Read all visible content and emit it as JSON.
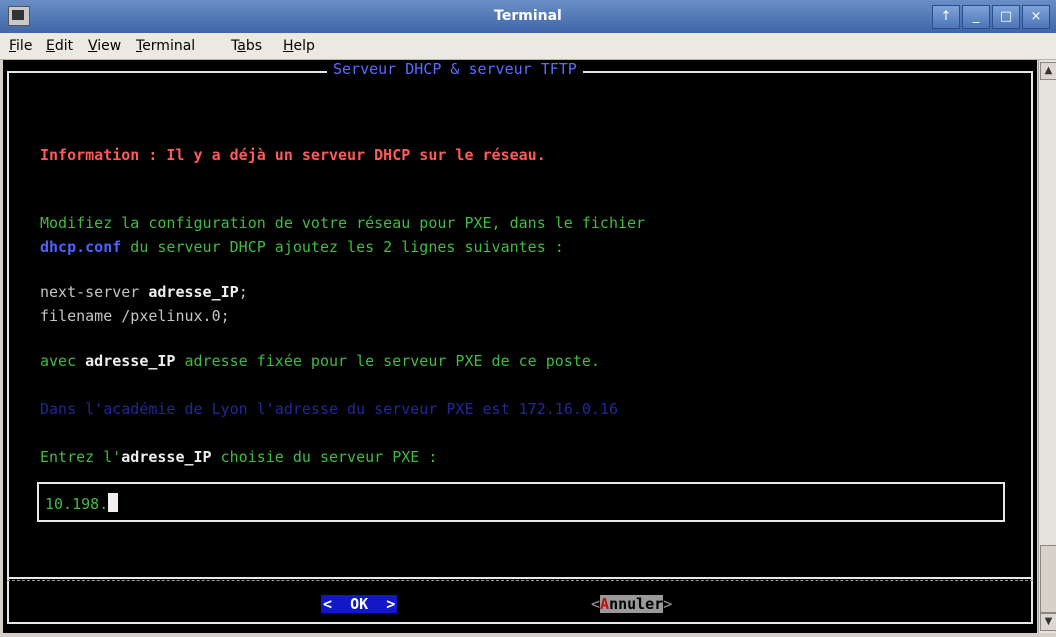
{
  "window": {
    "title": "Terminal",
    "buttons": {
      "up": "↑",
      "minimize": "_",
      "maximize": "□",
      "close": "×"
    }
  },
  "menubar": {
    "items": [
      {
        "key": "F",
        "rest": "ile"
      },
      {
        "key": "E",
        "rest": "dit"
      },
      {
        "key": "V",
        "rest": "iew"
      },
      {
        "key": "T",
        "rest": "erminal"
      },
      {
        "pre": "T",
        "key": "a",
        "rest": "bs"
      },
      {
        "key": "H",
        "rest": "elp"
      }
    ]
  },
  "dialog": {
    "title": "Serveur DHCP & serveur TFTP",
    "info": "Information : Il y a déjà un serveur DHCP sur le réseau.",
    "instr1": "Modifiez la configuration de votre réseau pour PXE, dans le fichier",
    "instr2_file": "dhcp.conf",
    "instr2_rest": " du serveur DHCP ajoutez les 2 lignes suivantes :",
    "code1_a": "next-server ",
    "code1_b": "adresse_IP",
    "code1_c": ";",
    "code2": "filename /pxelinux.0;",
    "avec_a": "avec ",
    "avec_b": "adresse_IP",
    "avec_c": " adresse fixée pour le serveur PXE de ce poste.",
    "lyon": "Dans l'académie de Lyon l'adresse du serveur PXE est 172.16.0.16",
    "prompt_a": "Entrez l'",
    "prompt_b": "adresse_IP",
    "prompt_c": " choisie du serveur PXE :",
    "input_value": "10.198.",
    "ok_label": "<  OK  >",
    "cancel_open": "<",
    "cancel_hot": "A",
    "cancel_rest": "nnuler",
    "cancel_close": ">"
  },
  "scrollbar": {
    "up": "▲",
    "down": "▼"
  }
}
